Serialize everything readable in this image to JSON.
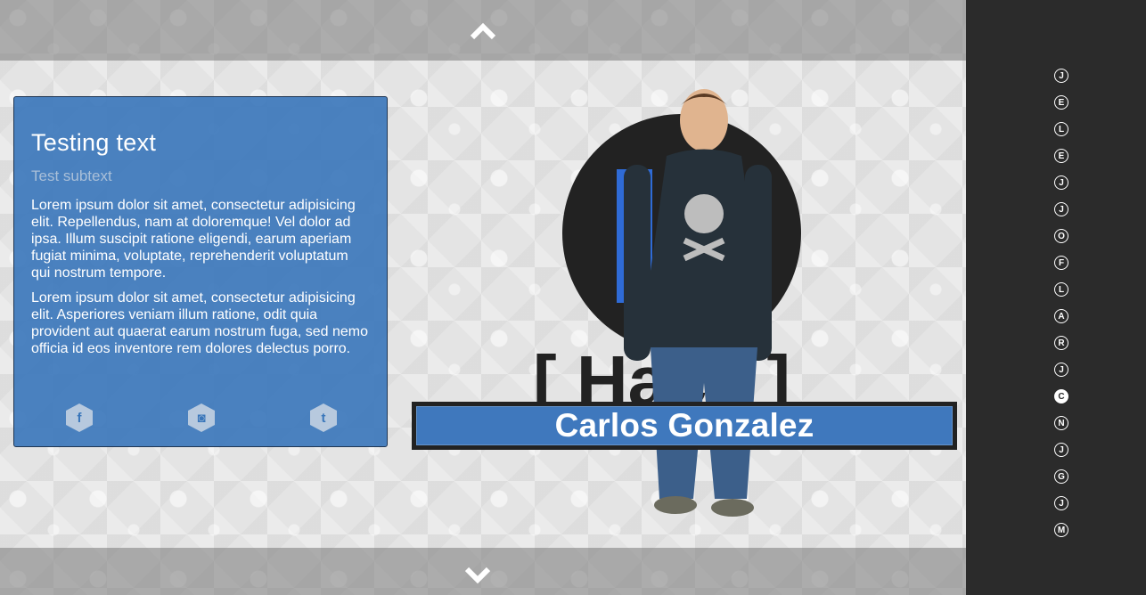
{
  "card": {
    "title": "Testing text",
    "subtitle": "Test subtext",
    "paragraphs": [
      "Lorem ipsum dolor sit amet, consectetur adipisicing elit. Repellendus, nam at doloremque! Vel dolor ad ipsa. Illum suscipit ratione eligendi, earum aperiam fugiat minima, voluptate, reprehenderit voluptatum qui nostrum tempore.",
      "Lorem ipsum dolor sit amet, consectetur adipisicing elit. Asperiores veniam illum ratione, odit quia provident aut quaerat earum nostrum fuga, sed nemo officia id eos inventore rem dolores delectus porro."
    ],
    "social": [
      {
        "icon": "facebook-icon",
        "glyph": "f"
      },
      {
        "icon": "instagram-icon",
        "glyph": "◙"
      },
      {
        "icon": "twitter-icon",
        "glyph": "t"
      }
    ]
  },
  "banner": {
    "name": "Carlos Gonzalez"
  },
  "sidebar": {
    "items": [
      {
        "letter": "J",
        "active": false
      },
      {
        "letter": "E",
        "active": false
      },
      {
        "letter": "L",
        "active": false
      },
      {
        "letter": "E",
        "active": false
      },
      {
        "letter": "J",
        "active": false
      },
      {
        "letter": "J",
        "active": false
      },
      {
        "letter": "O",
        "active": false
      },
      {
        "letter": "F",
        "active": false
      },
      {
        "letter": "L",
        "active": false
      },
      {
        "letter": "A",
        "active": false
      },
      {
        "letter": "R",
        "active": false
      },
      {
        "letter": "J",
        "active": false
      },
      {
        "letter": "C",
        "active": true
      },
      {
        "letter": "N",
        "active": false
      },
      {
        "letter": "J",
        "active": false
      },
      {
        "letter": "G",
        "active": false
      },
      {
        "letter": "J",
        "active": false
      },
      {
        "letter": "M",
        "active": false
      }
    ]
  },
  "colors": {
    "card": "#3976ba",
    "sidebar": "#2b2b2b",
    "banner": "#3f78bd"
  }
}
